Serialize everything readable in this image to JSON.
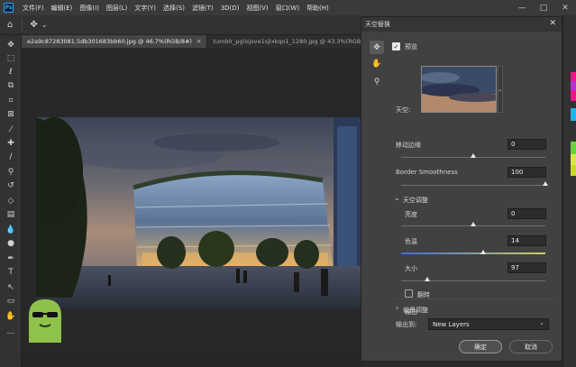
{
  "menubar": {
    "logo": "Ps",
    "items": [
      "文件(F)",
      "编辑(E)",
      "图像(I)",
      "图层(L)",
      "文字(Y)",
      "选择(S)",
      "滤镜(T)",
      "3D(D)",
      "视图(V)",
      "窗口(W)",
      "帮助(H)"
    ],
    "window_controls": [
      "—",
      "□",
      "✕"
    ]
  },
  "optionsbar": {
    "home_icon": "⌂",
    "move_icon": "✥",
    "dropdown_icon": "⌄"
  },
  "tabs": [
    {
      "label": "e2a9c87283081.5db301683bb60.jpg @ 46.7%(RGB/8#)",
      "close": "✕"
    },
    {
      "label": "tumblr_pgiisjsve1sjlxkqo1_1280.jpg @ 43.3%(RGB/8#)",
      "close": "✕"
    }
  ],
  "toolbar": {
    "tools": [
      "move-tool",
      "marquee-tool",
      "lasso-tool",
      "object-select-tool",
      "crop-tool",
      "frame-tool",
      "eyedropper-tool",
      "healing-tool",
      "brush-tool",
      "stamp-tool",
      "history-brush-tool",
      "eraser-tool",
      "gradient-tool",
      "blur-tool",
      "dodge-tool",
      "pen-tool",
      "type-tool",
      "path-select-tool",
      "rectangle-tool",
      "hand-tool",
      "more-tools"
    ],
    "glyphs": [
      "✥",
      "⬚",
      "ℓ",
      "⧉",
      "⌗",
      "⊠",
      "⁄",
      "✚",
      "∕",
      "⚲",
      "↺",
      "◇",
      "▤",
      "💧",
      "●",
      "✒",
      "T",
      "↖",
      "▭",
      "✋",
      "…"
    ]
  },
  "dialog": {
    "title": "天空替换",
    "close": "✕",
    "tools": [
      "move-sky-icon",
      "hand-icon",
      "zoom-icon"
    ],
    "tool_glyphs": [
      "✥",
      "✋",
      "⚲"
    ],
    "preview": {
      "label": "预览",
      "checked": true
    },
    "sky_label": "天空:",
    "shift_edge": {
      "label": "移动边缘",
      "value": "0",
      "position": 0.5
    },
    "fade_edge": {
      "label": "Border Smoothness",
      "value": "100",
      "position": 1.0
    },
    "sky_adjustments": {
      "label": "天空调整",
      "expanded": "⌄"
    },
    "brightness": {
      "label": "亮度",
      "value": "0",
      "position": 0.5
    },
    "temperature": {
      "label": "色温",
      "value": "14",
      "position": 0.57
    },
    "scale": {
      "label": "大小",
      "value": "97",
      "position": 0.18
    },
    "flip": {
      "label": "翻转",
      "checked": false
    },
    "foreground": {
      "label": "前景调整",
      "collapsed": "›"
    },
    "output": {
      "heading": "输出",
      "to_label": "输出到:",
      "value": "New Layers",
      "dropdown": "⌄"
    },
    "ok_label": "确定",
    "cancel_label": "取消"
  },
  "colors": {
    "accent_magenta": "#e8178a",
    "accent_cyan": "#1fb6e8",
    "accent_green": "#6cd23c",
    "mascot_green": "#8fc24a"
  }
}
